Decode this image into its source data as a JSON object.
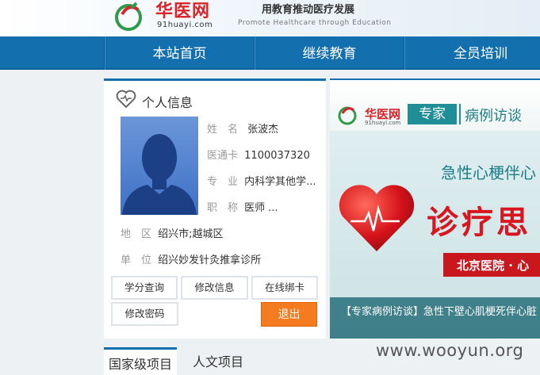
{
  "header": {
    "logo_cn": "华医网",
    "logo_en": "91huayi.com",
    "slogan_cn": "用教育推动医疗发展",
    "slogan_en": "Promote Healthcare through Education"
  },
  "nav": {
    "items": [
      {
        "label": "本站首页"
      },
      {
        "label": "继续教育"
      },
      {
        "label": "全员培训"
      }
    ]
  },
  "profile": {
    "title": "个人信息",
    "fields": [
      {
        "label": "姓　名",
        "value": "张波杰"
      },
      {
        "label": "医通卡",
        "value": "1100037320"
      },
      {
        "label": "专　业",
        "value": "内科学其他学..."
      },
      {
        "label": "职　称",
        "value": "医师 ..."
      },
      {
        "label": "地　区",
        "value": "绍兴市;越城区"
      },
      {
        "label": "单　位",
        "value": "绍兴妙发针灸推拿诊所"
      }
    ],
    "buttons": {
      "credits": "学分查询",
      "edit_info": "修改信息",
      "bind_card": "在线绑卡",
      "change_password": "修改密码",
      "logout": "退出"
    }
  },
  "banner": {
    "logo_cn": "华医网",
    "logo_en": "91huayi.com",
    "tag_expert": "专家",
    "tag_type": "病例访谈",
    "headline": "急性心梗伴心",
    "big_text": "诊疗思",
    "bar_text": "北京医院 · 心",
    "caption": "【专家病例访谈】急性下壁心肌梗死伴心脏"
  },
  "tabs": [
    {
      "label": "国家级项目",
      "active": true
    },
    {
      "label": "人文项目",
      "active": false
    }
  ],
  "watermark": "www.wooyun.org",
  "colors": {
    "brand_blue": "#136fae",
    "logout_orange": "#f47b1f",
    "logo_red": "#d9242a",
    "banner_teal": "#1f8e97"
  }
}
